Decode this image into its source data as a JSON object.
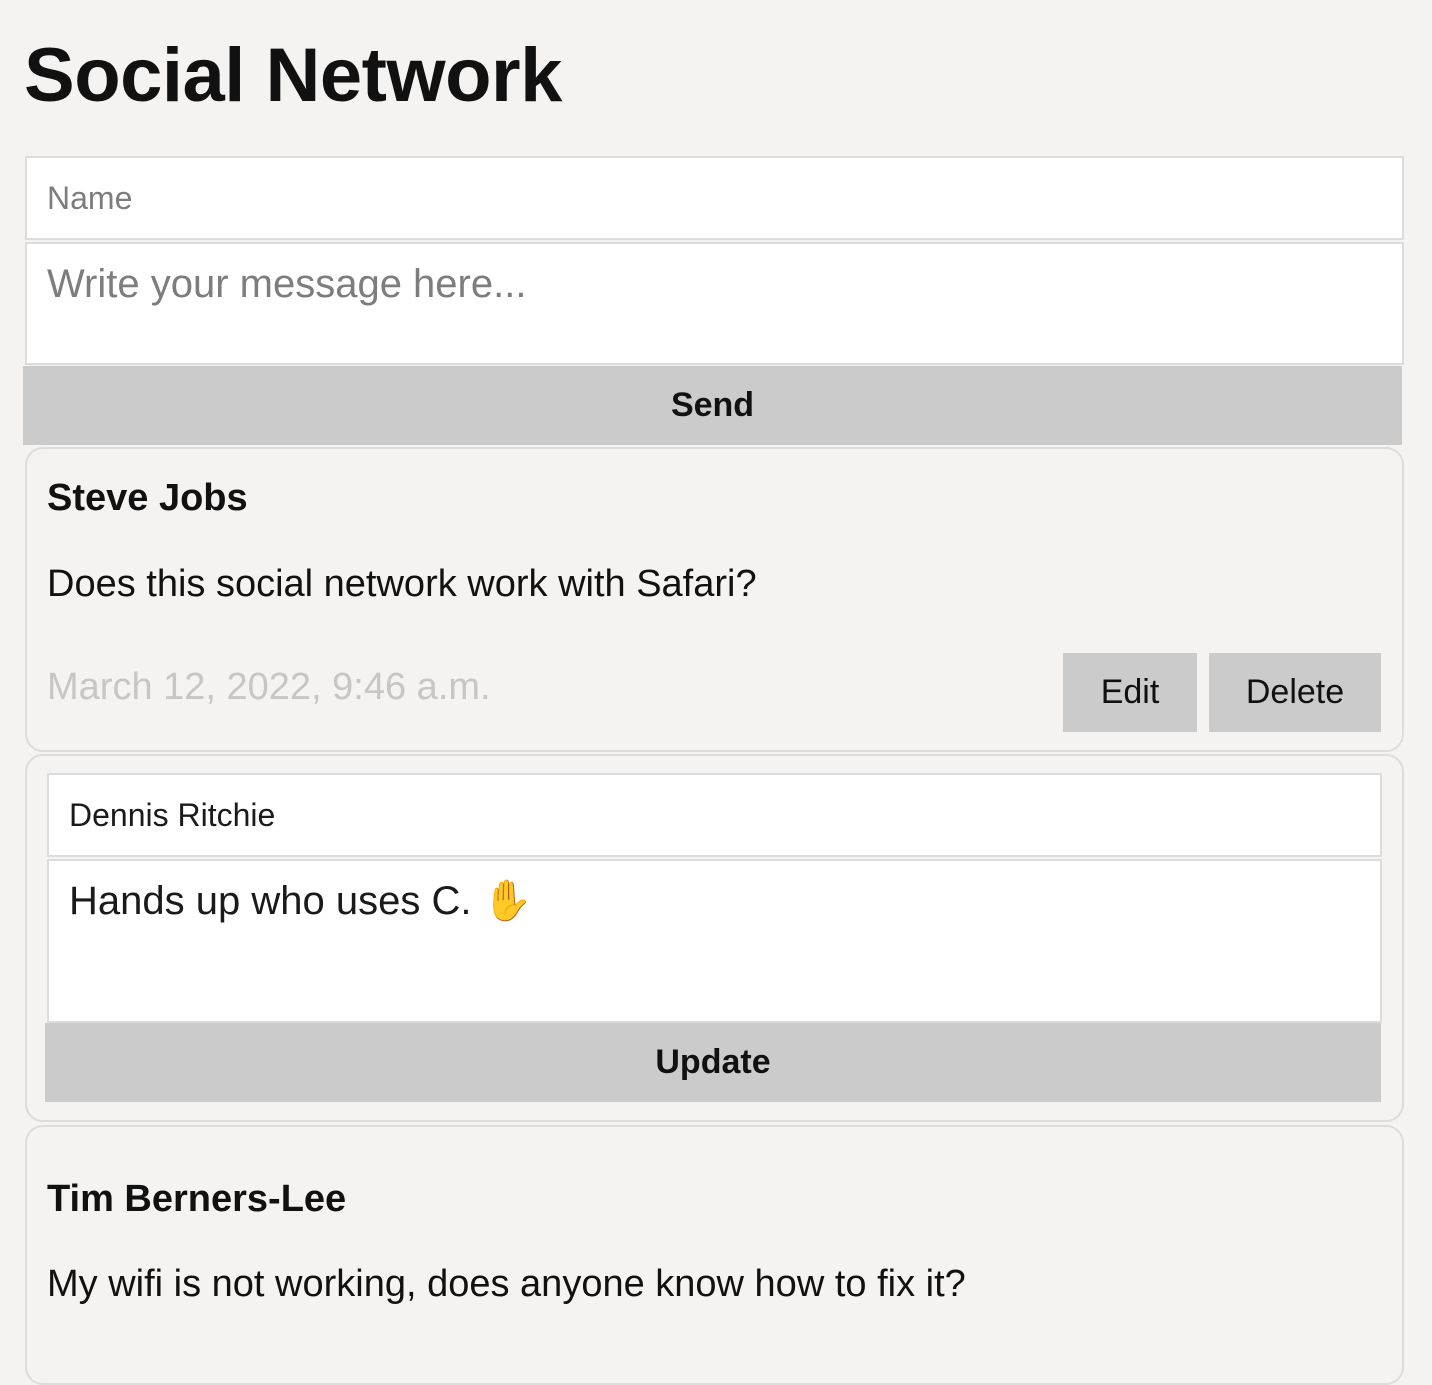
{
  "app": {
    "title": "Social Network"
  },
  "compose": {
    "name_placeholder": "Name",
    "message_placeholder": "Write your message here...",
    "send_label": "Send"
  },
  "posts": [
    {
      "author": "Steve Jobs",
      "message": "Does this social network work with Safari?",
      "date": "March 12, 2022, 9:46 a.m.",
      "edit_label": "Edit",
      "delete_label": "Delete"
    },
    {
      "editing": true,
      "author": "Dennis Ritchie",
      "message": "Hands up who uses C. ✋",
      "update_label": "Update"
    },
    {
      "author": "Tim Berners-Lee",
      "message": "My wifi is not working, does anyone know how to fix it?"
    }
  ]
}
